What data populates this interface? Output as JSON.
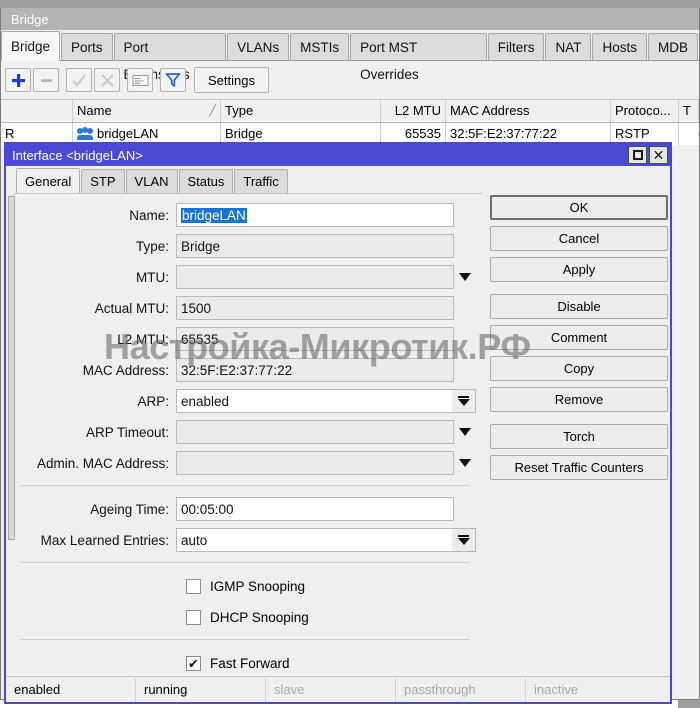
{
  "window": {
    "title": "Bridge",
    "tabs": [
      {
        "label": "Bridge",
        "active": true
      },
      {
        "label": "Ports",
        "active": false
      },
      {
        "label": "Port Extensions",
        "active": false
      },
      {
        "label": "VLANs",
        "active": false
      },
      {
        "label": "MSTIs",
        "active": false
      },
      {
        "label": "Port MST Overrides",
        "active": false
      },
      {
        "label": "Filters",
        "active": false
      },
      {
        "label": "NAT",
        "active": false
      },
      {
        "label": "Hosts",
        "active": false
      },
      {
        "label": "MDB",
        "active": false
      }
    ],
    "toolbar": {
      "add_label": "+",
      "remove_label": "−",
      "enable_label": "✓",
      "disable_label": "✕",
      "comment_label": "",
      "filter_label": "",
      "settings_label": "Settings"
    },
    "table": {
      "columns": [
        "",
        "Name",
        "Type",
        "L2 MTU",
        "MAC Address",
        "Protoco...",
        "T"
      ],
      "sort_column": "Name",
      "rows": [
        {
          "flags": "R",
          "name": "bridgeLAN",
          "type": "Bridge",
          "l2mtu": "65535",
          "mac": "32:5F:E2:37:77:22",
          "protocol": "RSTP",
          "tail": ""
        }
      ]
    }
  },
  "dialog": {
    "title": "Interface <bridgeLAN>",
    "maximize_label": "□",
    "close_label": "✕",
    "tabs": [
      {
        "label": "General",
        "active": true
      },
      {
        "label": "STP",
        "active": false
      },
      {
        "label": "VLAN",
        "active": false
      },
      {
        "label": "Status",
        "active": false
      },
      {
        "label": "Traffic",
        "active": false
      }
    ],
    "fields": [
      {
        "label": "Name:",
        "value": "bridgeLAN",
        "style": "white-selected"
      },
      {
        "label": "Type:",
        "value": "Bridge",
        "style": "readonly"
      },
      {
        "label": "MTU:",
        "value": "",
        "style": "readonly-arrow"
      },
      {
        "label": "Actual MTU:",
        "value": "1500",
        "style": "readonly"
      },
      {
        "label": "L2 MTU:",
        "value": "65535",
        "style": "readonly"
      },
      {
        "label": "MAC Address:",
        "value": "32:5F:E2:37:77:22",
        "style": "readonly"
      },
      {
        "label": "ARP:",
        "value": "enabled",
        "style": "combo"
      },
      {
        "label": "ARP Timeout:",
        "value": "",
        "style": "readonly-arrow"
      },
      {
        "label": "Admin. MAC Address:",
        "value": "",
        "style": "readonly-arrow"
      },
      {
        "label": "Ageing Time:",
        "value": "00:05:00",
        "style": "white"
      },
      {
        "label": "Max Learned Entries:",
        "value": "auto",
        "style": "combo-white"
      }
    ],
    "checkboxes": [
      {
        "label": "IGMP Snooping",
        "checked": false
      },
      {
        "label": "DHCP Snooping",
        "checked": false
      },
      {
        "label": "Fast Forward",
        "checked": true
      }
    ],
    "buttons": [
      {
        "label": "OK",
        "primary": true
      },
      {
        "label": "Cancel",
        "primary": false
      },
      {
        "label": "Apply",
        "primary": false
      },
      {
        "label": "Disable",
        "primary": false
      },
      {
        "label": "Comment",
        "primary": false
      },
      {
        "label": "Copy",
        "primary": false
      },
      {
        "label": "Remove",
        "primary": false
      },
      {
        "label": "Torch",
        "primary": false
      },
      {
        "label": "Reset Traffic Counters",
        "primary": false
      }
    ],
    "status": [
      {
        "label": "enabled",
        "dim": false
      },
      {
        "label": "running",
        "dim": false
      },
      {
        "label": "slave",
        "dim": true
      },
      {
        "label": "passthrough",
        "dim": true
      },
      {
        "label": "inactive",
        "dim": true
      }
    ]
  },
  "watermark": {
    "text": "Настройка-Микротик.РФ"
  },
  "colors": {
    "dialog_title_bg": "#4a4ad4",
    "accent_blue": "#1474d6",
    "window_title_bg": "#b4b4b4",
    "icon_blue": "#2040c0"
  }
}
